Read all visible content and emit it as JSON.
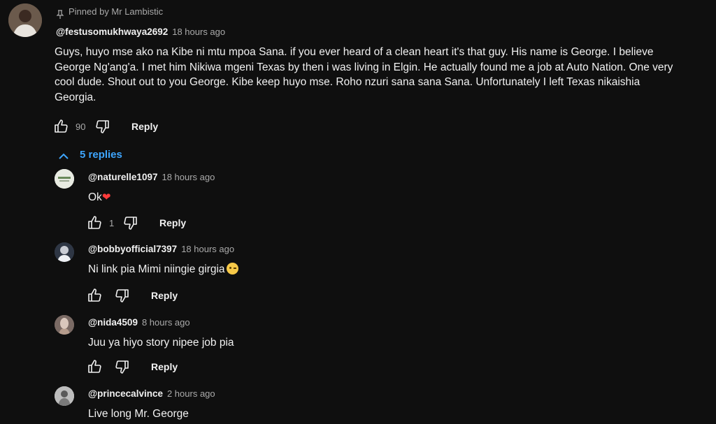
{
  "pinned": {
    "label": "Pinned by Mr Lambistic"
  },
  "main_comment": {
    "author": "@festusomukhwaya2692",
    "time": "18 hours ago",
    "lines": [
      "Guys, huyo mse ako na Kibe ni mtu mpoa Sana. if you ever heard of a clean heart it's that guy. His name is George. I believe",
      "George Ng'ang'a. I met him Nikiwa mgeni Texas by then i was living in Elgin. He actually found me a job at Auto Nation. One very",
      "cool dude. Shout out to you George. Kibe keep huyo mse. Roho nzuri sana sana Sana. Unfortunately I left Texas nikaishia",
      "Georgia."
    ],
    "likes": "90",
    "reply_label": "Reply"
  },
  "replies_toggle": {
    "label": "5 replies"
  },
  "replies": [
    {
      "author": "@naturelle1097",
      "time": "18 hours ago",
      "text": "Ok",
      "emoji": "heart",
      "likes": "1",
      "reply_label": "Reply"
    },
    {
      "author": "@bobbyofficial7397",
      "time": "18 hours ago",
      "text": "Ni link pia Mimi niingie girgia",
      "emoji": "wink",
      "likes": "",
      "reply_label": "Reply"
    },
    {
      "author": "@nida4509",
      "time": "8 hours ago",
      "text": "Juu ya hiyo story nipee job pia",
      "likes": "",
      "reply_label": "Reply"
    },
    {
      "author": "@princecalvince",
      "time": "2 hours ago",
      "text": "Live long Mr. George"
    }
  ],
  "colors": {
    "background": "#0f0f0f",
    "text": "#f1f1f1",
    "secondary": "#aaaaaa",
    "link": "#3ea6ff"
  }
}
